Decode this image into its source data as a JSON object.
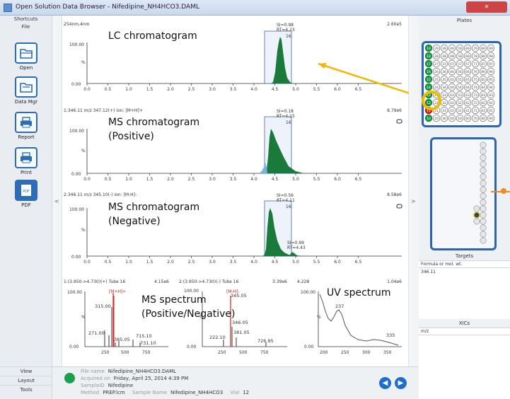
{
  "window": {
    "title": "Open Solution Data Browser - Nifedipine_NH4HCO3.DAML"
  },
  "sidebar": {
    "shortcuts": "Shortcuts",
    "file": "File",
    "items": [
      {
        "label": "Open",
        "icon": "folder-icon"
      },
      {
        "label": "Data Mgr",
        "icon": "folder-icon"
      },
      {
        "label": "Report",
        "icon": "printer-icon"
      },
      {
        "label": "Print",
        "icon": "printer-icon"
      },
      {
        "label": "PDF",
        "icon": "pdf-icon"
      }
    ],
    "bottom": [
      "View",
      "Layout",
      "Tools"
    ]
  },
  "collapse": {
    "left": "<",
    "right": ">"
  },
  "chromatograms": [
    {
      "header": "254nm,4nm",
      "scale": "2.60e5",
      "yticks": [
        "100.00",
        "%",
        "0.00"
      ],
      "xticks": [
        "0.0",
        "0.5",
        "1.0",
        "1.5",
        "2.0",
        "2.5",
        "3.0",
        "3.5",
        "4.0",
        "4.5",
        "5.0",
        "5.5",
        "6.0",
        "6.5"
      ],
      "peak": {
        "si": "SI=0.98",
        "rt": "RT=4.23",
        "tube": "16"
      },
      "annotation": [
        "LC chromatogram"
      ]
    },
    {
      "header": "1:346.11 m/z 347.12(+) ion: [M+H]+",
      "scale": "8.79e6",
      "yticks": [
        "100.00",
        "%",
        "0.00"
      ],
      "xticks": [
        "0.0",
        "0.5",
        "1.0",
        "1.5",
        "2.0",
        "2.5",
        "3.0",
        "3.5",
        "4.0",
        "4.5",
        "5.0",
        "5.5",
        "6.0",
        "6.5"
      ],
      "peak": {
        "si": "SI=0.18",
        "rt": "RT=4.15",
        "tube": "16"
      },
      "annotation": [
        "MS chromatogram",
        "(Positive)"
      ]
    },
    {
      "header": "2:346.11 m/z 345.10(-) ion: [M-H]-",
      "scale": "8.58e6",
      "yticks": [
        "100.00",
        "%",
        "0.00"
      ],
      "xticks": [
        "0.0",
        "0.5",
        "1.0",
        "1.5",
        "2.0",
        "2.5",
        "3.0",
        "3.5",
        "4.0",
        "4.5",
        "5.0",
        "5.5",
        "6.0",
        "6.5"
      ],
      "peak": {
        "si": "SI=0.56",
        "rt": "RT=4.11",
        "tube": "16",
        "si2": "SI=0.99",
        "rt2": "RT=4.43"
      },
      "annotation": [
        "MS chromatogram",
        "(Negative)"
      ]
    }
  ],
  "spectra": {
    "header1": "1:(3.950->4.730)(+) Tube 16",
    "scale1": "4.15e6",
    "header2": "2:(3.950->4.730)(-) Tube 16",
    "scale2": "3.39e6",
    "header3": "4.228",
    "scale3": "1.04e6",
    "pos": {
      "ion": "[M+H]+",
      "y100": "100.00",
      "ypct": "%",
      "y0": "0.00",
      "xticks": [
        "250",
        "500",
        "750"
      ],
      "peaks": [
        "315.00",
        "271.00",
        "385.05",
        "715.10",
        "731.10"
      ]
    },
    "neg": {
      "ion": "[M-H]-",
      "y100": "100.00",
      "ypct": "%",
      "y0": "0.00",
      "xticks": [
        "250",
        "500",
        "750"
      ],
      "peaks": [
        "345.05",
        "346.05",
        "381.05",
        "222.10",
        "726.95"
      ]
    },
    "uv": {
      "y100": "100.00",
      "ypct": "%",
      "y0": "0.00",
      "xticks": [
        "200",
        "250",
        "300",
        "350"
      ],
      "peaks": [
        "237",
        "335"
      ]
    },
    "ann_ms": [
      "MS spectrum",
      "(Positive/Negative)"
    ],
    "ann_uv": "UV spectrum"
  },
  "info": {
    "file_name_k": "File name",
    "file_name": "Nifedipine_NH4HCO3.DAML",
    "acquired_k": "Acquired on",
    "acquired": "Friday, April 25, 2014 4:39 PM",
    "sample_id_k": "SampleID",
    "sample_id": "Nifedipine",
    "method_k": "Method",
    "method": "PREP.lcm",
    "sample_name_k": "Sample Name",
    "sample_name": "Nifedipine_NH4HCO3",
    "vial_k": "Vial",
    "vial": "12"
  },
  "right": {
    "plates": "Plates",
    "targets": "Targets",
    "formula": "Formula or mol. wt.",
    "target_value": "346.11",
    "xics": "XICs",
    "mz": "m/z"
  },
  "plate_rows": [
    "19 29 39 49 59 69 79 89 99",
    "18 28 38 48 58 68 78 88 98",
    "17 27 37 47 57 67 77 87 97",
    "16 26 36 46 56 66 76 86 96",
    "15 25 35 45 55 65 75 85 95",
    "14 24 34 44 54 64 74 84 94",
    "13 23 33 43 53 63 73 83 93",
    "12 22 32 42 52 62 72 82 92",
    "11 21 31 41 51 61 71 81 91",
    "10 20 30 40 50 60 70 80 90"
  ],
  "colors": {
    "accent": "#2c64b3",
    "peak": "#1a7a3c",
    "arrow": "#f2b800",
    "arrow2": "#f08a1c"
  }
}
